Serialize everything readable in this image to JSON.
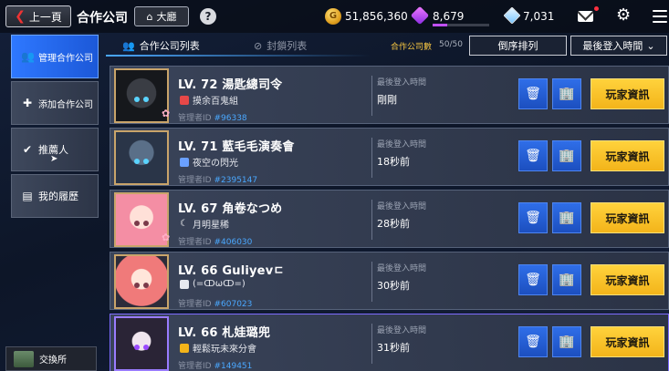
{
  "header": {
    "back_label": "上一頁",
    "title": "合作公司",
    "lobby_label": "大廳",
    "help_label": "?",
    "gold": "51,856,360",
    "gem": "8,679",
    "gem_progress": 0.25,
    "diamond": "7,031"
  },
  "sidebar": {
    "items": [
      {
        "label": "管理合作公司",
        "icon": "users-icon"
      },
      {
        "label": "添加合作公司",
        "icon": "add-user-icon"
      },
      {
        "label": "推薦人",
        "icon": "recommend-icon"
      },
      {
        "label": "我的履歷",
        "icon": "profile-card-icon"
      }
    ],
    "exchange_label": "交換所"
  },
  "tabs": {
    "partners": "合作公司列表",
    "blocked": "封鎖列表"
  },
  "count": {
    "label": "合作公司數",
    "value": "50/50"
  },
  "sort": {
    "reverse_label": "倒序排列",
    "select_value": "最後登入時間"
  },
  "rows": [
    {
      "level": "LV. 72",
      "name": "湯匙總司令",
      "guild": "摸余百鬼組",
      "manager_label": "管理者ID",
      "manager_id": "#96338",
      "last_label": "最後登入時間",
      "last_value": "剛剛",
      "info_label": "玩家資訊"
    },
    {
      "level": "LV. 71",
      "name": "藍毛毛演奏會",
      "guild": "夜空の閃光",
      "manager_label": "管理者ID",
      "manager_id": "#2395147",
      "last_label": "最後登入時間",
      "last_value": "18秒前",
      "info_label": "玩家資訊"
    },
    {
      "level": "LV. 67",
      "name": "角卷なつめ",
      "guild": "月明星稀",
      "manager_label": "管理者ID",
      "manager_id": "#406030",
      "last_label": "最後登入時間",
      "last_value": "28秒前",
      "info_label": "玩家資訊"
    },
    {
      "level": "LV. 66",
      "name": "Guliyevㄷ",
      "guild": "(=ↀωↀ=)",
      "manager_label": "管理者ID",
      "manager_id": "#607023",
      "last_label": "最後登入時間",
      "last_value": "30秒前",
      "info_label": "玩家資訊"
    },
    {
      "level": "LV. 66",
      "name": "札娃璐兜",
      "guild": "輕鬆玩未來分會",
      "manager_label": "管理者ID",
      "manager_id": "#149451",
      "last_label": "最後登入時間",
      "last_value": "31秒前",
      "info_label": "玩家資訊"
    }
  ],
  "colors": {
    "accent_blue": "#2e78ff",
    "info_yellow": "#ffd23c",
    "manager_id_blue": "#4aa8ff",
    "count_gold": "#f5c542"
  }
}
